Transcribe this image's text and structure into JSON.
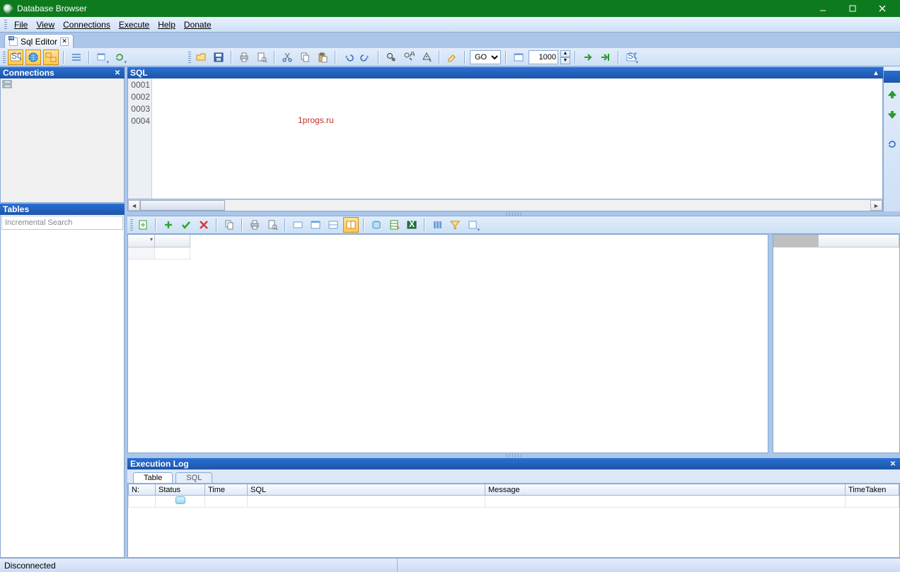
{
  "title": "Database Browser",
  "menu": {
    "file": "File",
    "view": "View",
    "connections": "Connections",
    "execute": "Execute",
    "help": "Help",
    "donate": "Donate"
  },
  "tabs": {
    "sql_editor": "Sql Editor"
  },
  "panels": {
    "connections": "Connections",
    "tables": "Tables",
    "sql": "SQL",
    "execution_log": "Execution Log"
  },
  "search_placeholder": "Incremental Search",
  "toolbar": {
    "go_options": [
      "GO"
    ],
    "go_selected": "GO",
    "limit_value": "1000"
  },
  "editor": {
    "gutter_lines": [
      "0001",
      "0002",
      "0003",
      "0004"
    ],
    "watermark": "1progs.ru"
  },
  "exec_tabs": {
    "table": "Table",
    "sql": "SQL"
  },
  "exec_cols": {
    "n": "N:",
    "status": "Status",
    "time": "Time",
    "sql": "SQL",
    "message": "Message",
    "timetaken": "TimeTaken"
  },
  "status": {
    "text": "Disconnected"
  }
}
